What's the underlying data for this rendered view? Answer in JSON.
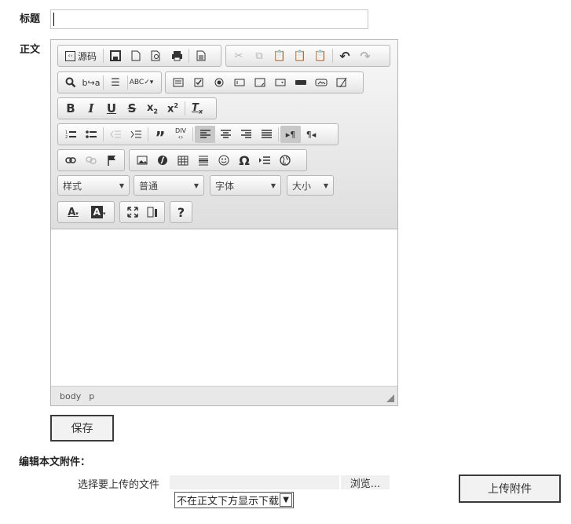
{
  "form": {
    "title_label": "标题",
    "body_label": "正文",
    "title_value": "",
    "save_label": "保存",
    "attachments_heading": "编辑本文附件：",
    "choose_file_label": "选择要上传的文件",
    "browse_label": "浏览...",
    "display_option": "不在正文下方显示下载",
    "upload_label": "上传附件"
  },
  "editor": {
    "source_label": "源码",
    "format_styles": "样式",
    "format_paragraph": "普通",
    "font_family": "字体",
    "font_size": "大小",
    "path": [
      "body",
      "p"
    ]
  },
  "colors": {
    "text": "#222222",
    "toolbar_bg": "#e4e4e4",
    "border": "#b6b6b6"
  }
}
